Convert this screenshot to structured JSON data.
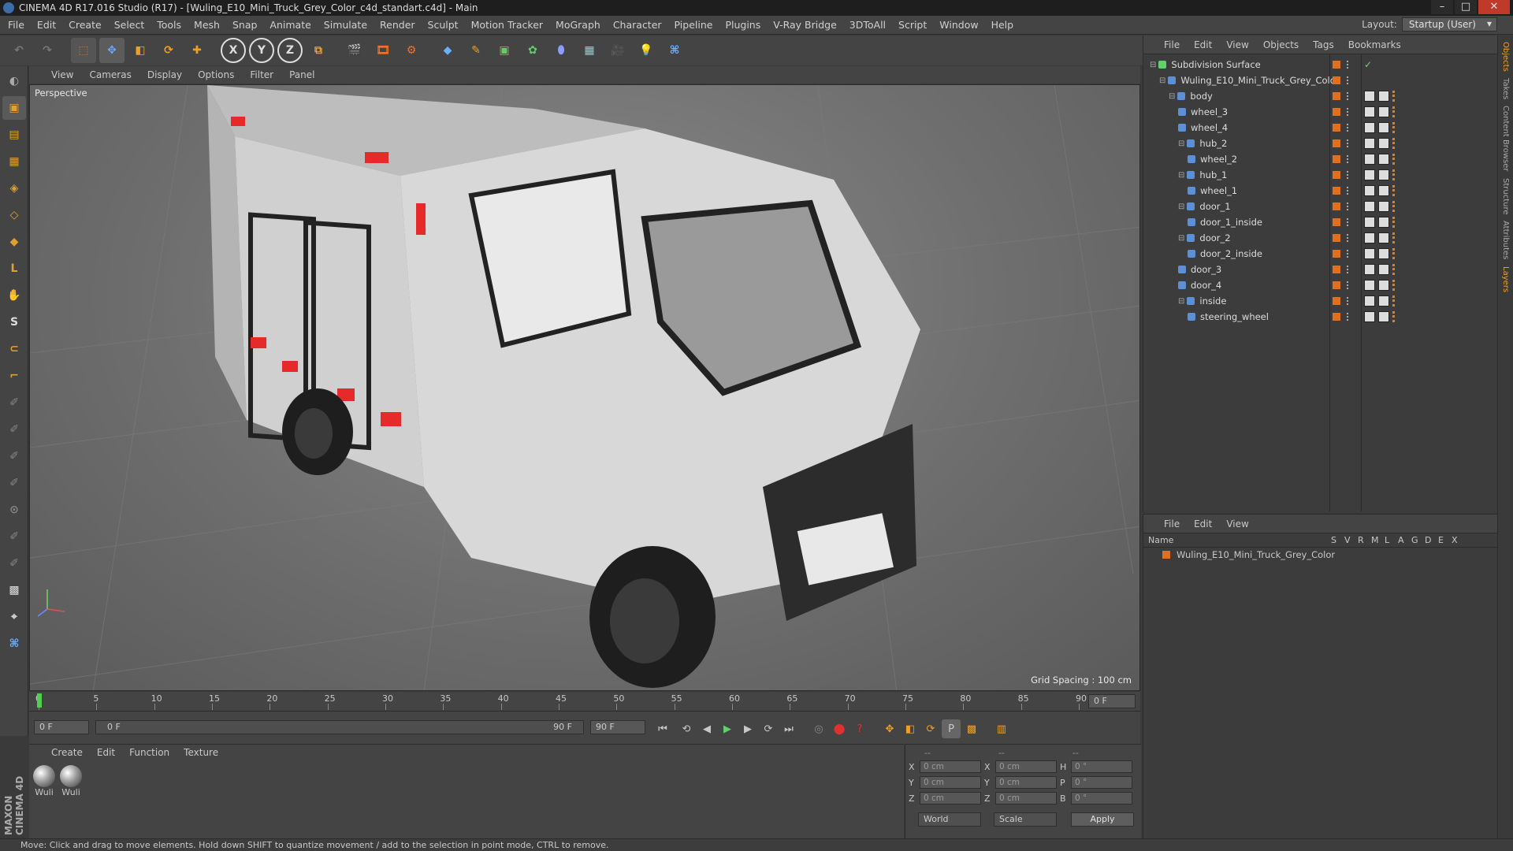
{
  "window": {
    "title": "CINEMA 4D R17.016 Studio (R17) - [Wuling_E10_Mini_Truck_Grey_Color_c4d_standart.c4d] - Main"
  },
  "menu": [
    "File",
    "Edit",
    "Create",
    "Select",
    "Tools",
    "Mesh",
    "Snap",
    "Animate",
    "Simulate",
    "Render",
    "Sculpt",
    "Motion Tracker",
    "MoGraph",
    "Character",
    "Pipeline",
    "Plugins",
    "V-Ray Bridge",
    "3DToAll",
    "Script",
    "Window",
    "Help"
  ],
  "layout": {
    "label": "Layout:",
    "value": "Startup (User)"
  },
  "viewport": {
    "menu": [
      "View",
      "Cameras",
      "Display",
      "Options",
      "Filter",
      "Panel"
    ],
    "label": "Perspective",
    "grid_spacing": "Grid Spacing : 100 cm"
  },
  "timeline": {
    "ticks": [
      "0",
      "5",
      "10",
      "15",
      "20",
      "25",
      "30",
      "35",
      "40",
      "45",
      "50",
      "55",
      "60",
      "65",
      "70",
      "75",
      "80",
      "85",
      "90"
    ],
    "current": "0 F",
    "start": "0 F",
    "range_start": "0 F",
    "range_end": "90 F",
    "end": "90 F"
  },
  "material_panel": {
    "menu": [
      "Create",
      "Edit",
      "Function",
      "Texture"
    ],
    "materials": [
      "Wuli",
      "Wuli"
    ]
  },
  "coords": {
    "header": [
      "--",
      "--",
      "--"
    ],
    "rows": [
      {
        "a": "X",
        "av": "0 cm",
        "b": "X",
        "bv": "0 cm",
        "c": "H",
        "cv": "0 °"
      },
      {
        "a": "Y",
        "av": "0 cm",
        "b": "Y",
        "bv": "0 cm",
        "c": "P",
        "cv": "0 °"
      },
      {
        "a": "Z",
        "av": "0 cm",
        "b": "Z",
        "bv": "0 cm",
        "c": "B",
        "cv": "0 °"
      }
    ],
    "world": "World",
    "scale": "Scale",
    "apply": "Apply"
  },
  "object_manager": {
    "menu": [
      "File",
      "Edit",
      "View",
      "Objects",
      "Tags",
      "Bookmarks"
    ],
    "objects": [
      {
        "name": "Subdivision Surface",
        "depth": 0,
        "icon": "subdivision-icon"
      },
      {
        "name": "Wuling_E10_Mini_Truck_Grey_Color",
        "depth": 1,
        "icon": "null-icon"
      },
      {
        "name": "body",
        "depth": 2,
        "icon": "polygon-icon"
      },
      {
        "name": "wheel_3",
        "depth": 3,
        "icon": "polygon-icon"
      },
      {
        "name": "wheel_4",
        "depth": 3,
        "icon": "polygon-icon"
      },
      {
        "name": "hub_2",
        "depth": 3,
        "icon": "polygon-icon"
      },
      {
        "name": "wheel_2",
        "depth": 4,
        "icon": "polygon-icon"
      },
      {
        "name": "hub_1",
        "depth": 3,
        "icon": "polygon-icon"
      },
      {
        "name": "wheel_1",
        "depth": 4,
        "icon": "polygon-icon"
      },
      {
        "name": "door_1",
        "depth": 3,
        "icon": "polygon-icon"
      },
      {
        "name": "door_1_inside",
        "depth": 4,
        "icon": "polygon-icon"
      },
      {
        "name": "door_2",
        "depth": 3,
        "icon": "polygon-icon"
      },
      {
        "name": "door_2_inside",
        "depth": 4,
        "icon": "polygon-icon"
      },
      {
        "name": "door_3",
        "depth": 3,
        "icon": "polygon-icon"
      },
      {
        "name": "door_4",
        "depth": 3,
        "icon": "polygon-icon"
      },
      {
        "name": "inside",
        "depth": 3,
        "icon": "polygon-icon"
      },
      {
        "name": "steering_wheel",
        "depth": 4,
        "icon": "polygon-icon"
      }
    ]
  },
  "layer_manager": {
    "menu": [
      "File",
      "Edit",
      "View"
    ],
    "name_header": "Name",
    "columns": [
      "S",
      "V",
      "R",
      "M",
      "L",
      "A",
      "G",
      "D",
      "E",
      "X"
    ],
    "layers": [
      "Wuling_E10_Mini_Truck_Grey_Color"
    ]
  },
  "right_tabs": [
    "Objects",
    "Takes",
    "Content Browser",
    "Structure",
    "Attributes",
    "Layers"
  ],
  "brand": "MAXON CINEMA 4D",
  "status": "Move: Click and drag to move elements. Hold down SHIFT to quantize movement / add to the selection in point mode, CTRL to remove.",
  "colors": {
    "accent": "#e07020",
    "selection": "#5c8fd6",
    "background": "#3a3a3a"
  }
}
